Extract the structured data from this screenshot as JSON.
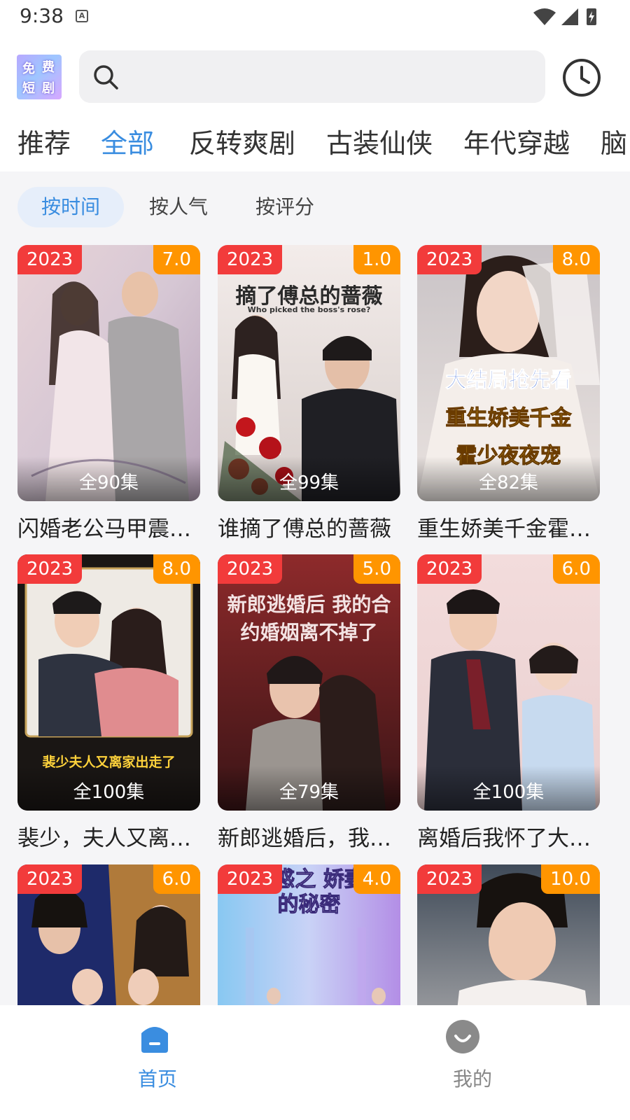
{
  "status": {
    "time": "9:38",
    "notification_icon": "A"
  },
  "search": {
    "placeholder": ""
  },
  "logo": {
    "chars": [
      "免",
      "费",
      "短",
      "剧"
    ]
  },
  "tabs": [
    "推荐",
    "全部",
    "反转爽剧",
    "古装仙侠",
    "年代穿越",
    "脑"
  ],
  "active_tab": 1,
  "sort": [
    "按时间",
    "按人气",
    "按评分"
  ],
  "active_sort": 0,
  "dramas": [
    {
      "year": "2023",
      "score": "7.0",
      "episodes": "全90集",
      "title": "闪婚老公马甲震…"
    },
    {
      "year": "2023",
      "score": "1.0",
      "episodes": "全99集",
      "title": "谁摘了傅总的蔷薇"
    },
    {
      "year": "2023",
      "score": "8.0",
      "episodes": "全82集",
      "title": "重生娇美千金霍…"
    },
    {
      "year": "2023",
      "score": "8.0",
      "episodes": "全100集",
      "title": "裴少，夫人又离…"
    },
    {
      "year": "2023",
      "score": "5.0",
      "episodes": "全79集",
      "title": "新郎逃婚后，我…"
    },
    {
      "year": "2023",
      "score": "6.0",
      "episodes": "全100集",
      "title": "离婚后我怀了大…"
    },
    {
      "year": "2023",
      "score": "6.0",
      "episodes": "",
      "title": ""
    },
    {
      "year": "2023",
      "score": "4.0",
      "episodes": "",
      "title": ""
    },
    {
      "year": "2023",
      "score": "10.0",
      "episodes": "",
      "title": ""
    }
  ],
  "poster_text": {
    "p2_title": "摘了傅总的蔷薇",
    "p2_en": "Who picked the boss's rose?",
    "p3_lines": [
      "大结局抢先看",
      "重生娇美千金",
      "霍少夜夜宠"
    ],
    "p4_banner": "裴少夫人又离家出走了",
    "p5_title": "新郎逃婚后 我的合约婚姻离不掉了",
    "p8_title": "诱惑之 娇妻的秘密"
  },
  "nav": [
    {
      "label": "首页",
      "icon": "home-icon",
      "active": true
    },
    {
      "label": "我的",
      "icon": "profile-smile-icon",
      "active": false
    }
  ],
  "colors": {
    "accent": "#3a8de0",
    "year_badge": "#f23b3b",
    "score_badge": "#ff9500"
  }
}
